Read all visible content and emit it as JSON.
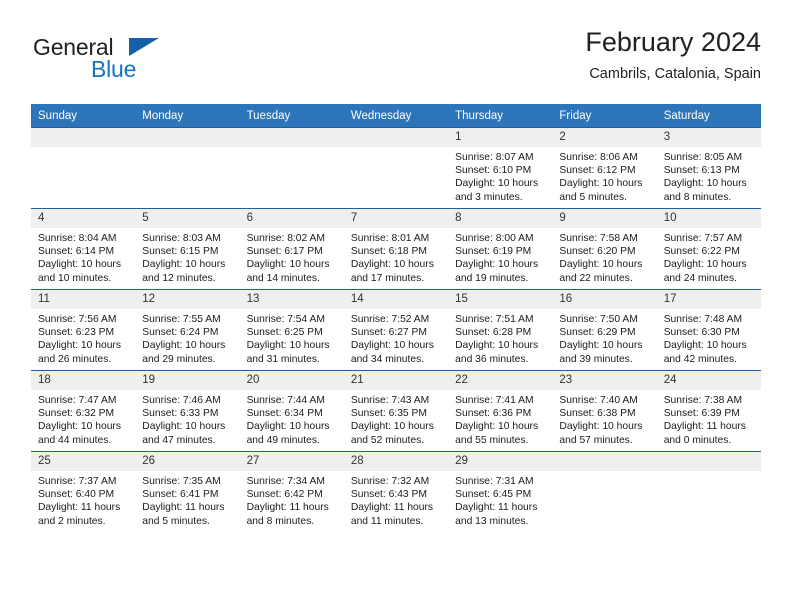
{
  "brand": {
    "name_part1": "General",
    "name_part2": "Blue",
    "triangle_color": "#1461a8",
    "blue_color": "#1574c4"
  },
  "header": {
    "title": "February 2024",
    "subtitle": "Cambrils, Catalonia, Spain"
  },
  "theme": {
    "header_bg": "#2d75ba",
    "row_border": "#1f5fa0",
    "daynum_bg": "#efefef"
  },
  "weekdays": [
    "Sunday",
    "Monday",
    "Tuesday",
    "Wednesday",
    "Thursday",
    "Friday",
    "Saturday"
  ],
  "weeks": [
    [
      {
        "day": "",
        "sunrise": "",
        "sunset": "",
        "daylight1": "",
        "daylight2": ""
      },
      {
        "day": "",
        "sunrise": "",
        "sunset": "",
        "daylight1": "",
        "daylight2": ""
      },
      {
        "day": "",
        "sunrise": "",
        "sunset": "",
        "daylight1": "",
        "daylight2": ""
      },
      {
        "day": "",
        "sunrise": "",
        "sunset": "",
        "daylight1": "",
        "daylight2": ""
      },
      {
        "day": "1",
        "sunrise": "Sunrise: 8:07 AM",
        "sunset": "Sunset: 6:10 PM",
        "daylight1": "Daylight: 10 hours",
        "daylight2": "and 3 minutes."
      },
      {
        "day": "2",
        "sunrise": "Sunrise: 8:06 AM",
        "sunset": "Sunset: 6:12 PM",
        "daylight1": "Daylight: 10 hours",
        "daylight2": "and 5 minutes."
      },
      {
        "day": "3",
        "sunrise": "Sunrise: 8:05 AM",
        "sunset": "Sunset: 6:13 PM",
        "daylight1": "Daylight: 10 hours",
        "daylight2": "and 8 minutes."
      }
    ],
    [
      {
        "day": "4",
        "sunrise": "Sunrise: 8:04 AM",
        "sunset": "Sunset: 6:14 PM",
        "daylight1": "Daylight: 10 hours",
        "daylight2": "and 10 minutes."
      },
      {
        "day": "5",
        "sunrise": "Sunrise: 8:03 AM",
        "sunset": "Sunset: 6:15 PM",
        "daylight1": "Daylight: 10 hours",
        "daylight2": "and 12 minutes."
      },
      {
        "day": "6",
        "sunrise": "Sunrise: 8:02 AM",
        "sunset": "Sunset: 6:17 PM",
        "daylight1": "Daylight: 10 hours",
        "daylight2": "and 14 minutes."
      },
      {
        "day": "7",
        "sunrise": "Sunrise: 8:01 AM",
        "sunset": "Sunset: 6:18 PM",
        "daylight1": "Daylight: 10 hours",
        "daylight2": "and 17 minutes."
      },
      {
        "day": "8",
        "sunrise": "Sunrise: 8:00 AM",
        "sunset": "Sunset: 6:19 PM",
        "daylight1": "Daylight: 10 hours",
        "daylight2": "and 19 minutes."
      },
      {
        "day": "9",
        "sunrise": "Sunrise: 7:58 AM",
        "sunset": "Sunset: 6:20 PM",
        "daylight1": "Daylight: 10 hours",
        "daylight2": "and 22 minutes."
      },
      {
        "day": "10",
        "sunrise": "Sunrise: 7:57 AM",
        "sunset": "Sunset: 6:22 PM",
        "daylight1": "Daylight: 10 hours",
        "daylight2": "and 24 minutes."
      }
    ],
    [
      {
        "day": "11",
        "sunrise": "Sunrise: 7:56 AM",
        "sunset": "Sunset: 6:23 PM",
        "daylight1": "Daylight: 10 hours",
        "daylight2": "and 26 minutes."
      },
      {
        "day": "12",
        "sunrise": "Sunrise: 7:55 AM",
        "sunset": "Sunset: 6:24 PM",
        "daylight1": "Daylight: 10 hours",
        "daylight2": "and 29 minutes."
      },
      {
        "day": "13",
        "sunrise": "Sunrise: 7:54 AM",
        "sunset": "Sunset: 6:25 PM",
        "daylight1": "Daylight: 10 hours",
        "daylight2": "and 31 minutes."
      },
      {
        "day": "14",
        "sunrise": "Sunrise: 7:52 AM",
        "sunset": "Sunset: 6:27 PM",
        "daylight1": "Daylight: 10 hours",
        "daylight2": "and 34 minutes."
      },
      {
        "day": "15",
        "sunrise": "Sunrise: 7:51 AM",
        "sunset": "Sunset: 6:28 PM",
        "daylight1": "Daylight: 10 hours",
        "daylight2": "and 36 minutes."
      },
      {
        "day": "16",
        "sunrise": "Sunrise: 7:50 AM",
        "sunset": "Sunset: 6:29 PM",
        "daylight1": "Daylight: 10 hours",
        "daylight2": "and 39 minutes."
      },
      {
        "day": "17",
        "sunrise": "Sunrise: 7:48 AM",
        "sunset": "Sunset: 6:30 PM",
        "daylight1": "Daylight: 10 hours",
        "daylight2": "and 42 minutes."
      }
    ],
    [
      {
        "day": "18",
        "sunrise": "Sunrise: 7:47 AM",
        "sunset": "Sunset: 6:32 PM",
        "daylight1": "Daylight: 10 hours",
        "daylight2": "and 44 minutes."
      },
      {
        "day": "19",
        "sunrise": "Sunrise: 7:46 AM",
        "sunset": "Sunset: 6:33 PM",
        "daylight1": "Daylight: 10 hours",
        "daylight2": "and 47 minutes."
      },
      {
        "day": "20",
        "sunrise": "Sunrise: 7:44 AM",
        "sunset": "Sunset: 6:34 PM",
        "daylight1": "Daylight: 10 hours",
        "daylight2": "and 49 minutes."
      },
      {
        "day": "21",
        "sunrise": "Sunrise: 7:43 AM",
        "sunset": "Sunset: 6:35 PM",
        "daylight1": "Daylight: 10 hours",
        "daylight2": "and 52 minutes."
      },
      {
        "day": "22",
        "sunrise": "Sunrise: 7:41 AM",
        "sunset": "Sunset: 6:36 PM",
        "daylight1": "Daylight: 10 hours",
        "daylight2": "and 55 minutes."
      },
      {
        "day": "23",
        "sunrise": "Sunrise: 7:40 AM",
        "sunset": "Sunset: 6:38 PM",
        "daylight1": "Daylight: 10 hours",
        "daylight2": "and 57 minutes."
      },
      {
        "day": "24",
        "sunrise": "Sunrise: 7:38 AM",
        "sunset": "Sunset: 6:39 PM",
        "daylight1": "Daylight: 11 hours",
        "daylight2": "and 0 minutes."
      }
    ],
    [
      {
        "day": "25",
        "sunrise": "Sunrise: 7:37 AM",
        "sunset": "Sunset: 6:40 PM",
        "daylight1": "Daylight: 11 hours",
        "daylight2": "and 2 minutes."
      },
      {
        "day": "26",
        "sunrise": "Sunrise: 7:35 AM",
        "sunset": "Sunset: 6:41 PM",
        "daylight1": "Daylight: 11 hours",
        "daylight2": "and 5 minutes."
      },
      {
        "day": "27",
        "sunrise": "Sunrise: 7:34 AM",
        "sunset": "Sunset: 6:42 PM",
        "daylight1": "Daylight: 11 hours",
        "daylight2": "and 8 minutes."
      },
      {
        "day": "28",
        "sunrise": "Sunrise: 7:32 AM",
        "sunset": "Sunset: 6:43 PM",
        "daylight1": "Daylight: 11 hours",
        "daylight2": "and 11 minutes."
      },
      {
        "day": "29",
        "sunrise": "Sunrise: 7:31 AM",
        "sunset": "Sunset: 6:45 PM",
        "daylight1": "Daylight: 11 hours",
        "daylight2": "and 13 minutes."
      },
      {
        "day": "",
        "sunrise": "",
        "sunset": "",
        "daylight1": "",
        "daylight2": ""
      },
      {
        "day": "",
        "sunrise": "",
        "sunset": "",
        "daylight1": "",
        "daylight2": ""
      }
    ]
  ]
}
